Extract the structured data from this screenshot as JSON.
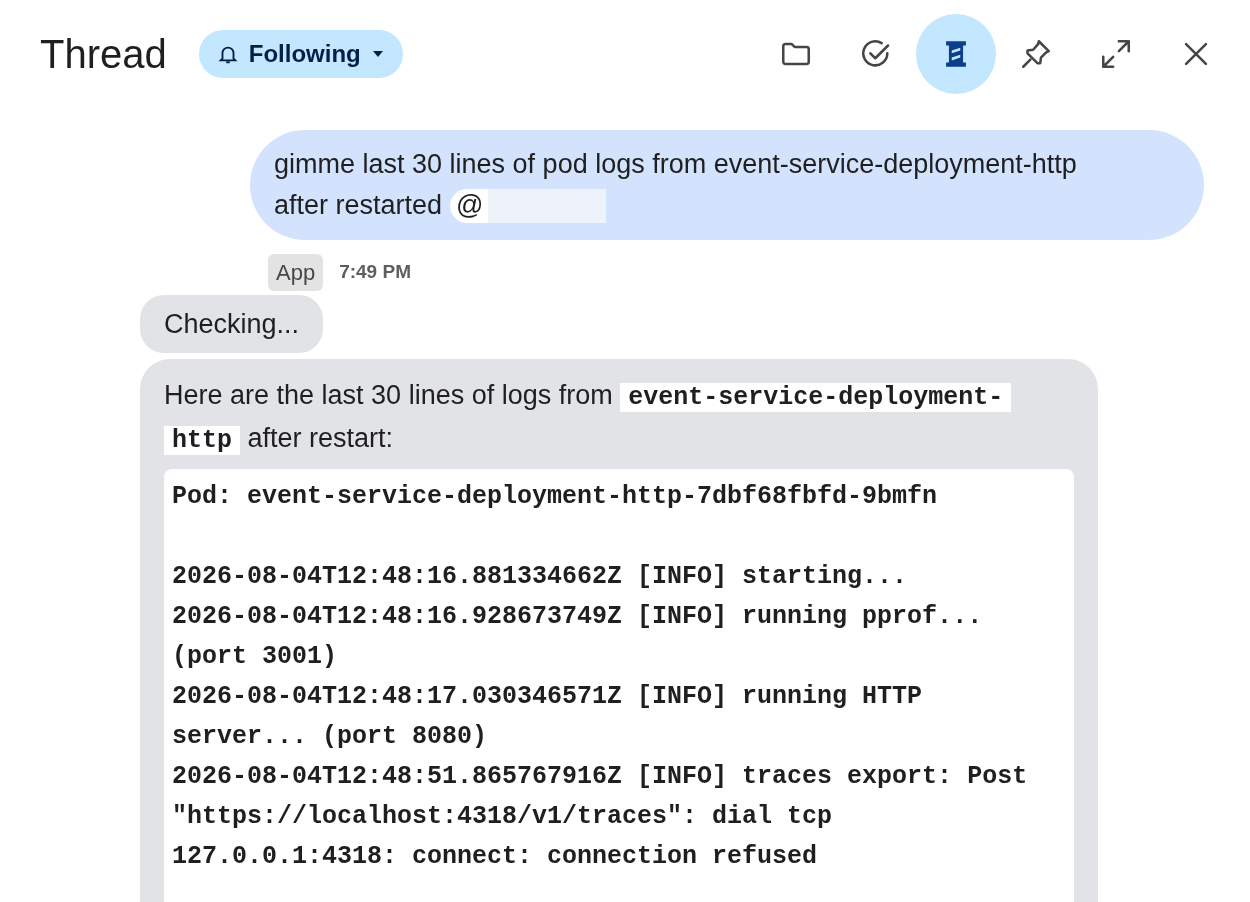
{
  "header": {
    "title": "Thread",
    "follow_button": {
      "label": "Following"
    },
    "toolbar": [
      {
        "kind": "folder",
        "selected": false
      },
      {
        "kind": "task",
        "selected": false
      },
      {
        "kind": "thread",
        "selected": true
      },
      {
        "kind": "pin",
        "selected": false
      },
      {
        "kind": "expand",
        "selected": false
      },
      {
        "kind": "close",
        "selected": false
      }
    ]
  },
  "user_message": {
    "text_lines": [
      "gimme last 30 lines of pod logs from event-service-deployment-http",
      "after restarted"
    ],
    "mention": "@"
  },
  "reply": {
    "sender": "App",
    "time": "7:49 PM",
    "status": "Checking...",
    "intro": "Here are the last 30 lines of logs from",
    "code_lines": [
      "event-service-deployment-",
      "http"
    ],
    "outro": "after restart:",
    "pod": "Pod: event-service-deployment-http-7dbf68fbfd-9bmfn",
    "log_lines": [
      "2026-08-04T12:48:16.881334662Z [INFO] starting...",
      "2026-08-04T12:48:16.928673749Z [INFO] running pprof...",
      "(port 3001)",
      "2026-08-04T12:48:17.030346571Z [INFO] running HTTP",
      "server... (port 8080)",
      "2026-08-04T12:48:51.865767916Z [INFO] traces export: Post",
      "\"https://localhost:4318/v1/traces\": dial tcp",
      "127.0.0.1:4318: connect: connection refused"
    ]
  }
}
